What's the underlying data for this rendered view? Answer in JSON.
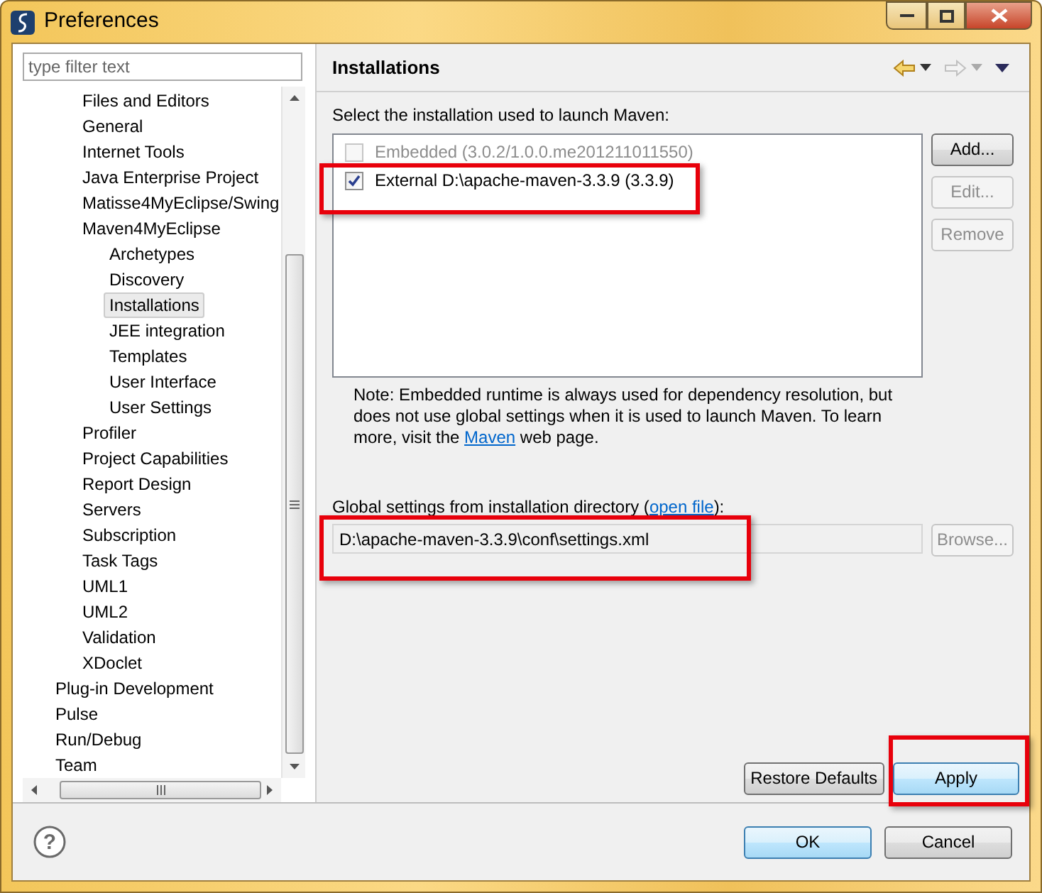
{
  "window": {
    "title": "Preferences"
  },
  "filter": {
    "placeholder": "type filter text"
  },
  "tree": {
    "items": [
      {
        "children": [
          {
            "label": "Files and Editors",
            "selected": false
          },
          {
            "label": "General",
            "selected": false
          },
          {
            "label": "Internet Tools",
            "selected": false
          },
          {
            "label": "Java Enterprise Project",
            "selected": false
          },
          {
            "label": "Matisse4MyEclipse/Swing",
            "selected": false
          },
          {
            "label": "Maven4MyEclipse",
            "selected": false,
            "children": [
              {
                "label": "Archetypes",
                "selected": false
              },
              {
                "label": "Discovery",
                "selected": false
              },
              {
                "label": "Installations",
                "selected": true
              },
              {
                "label": "JEE integration",
                "selected": false
              },
              {
                "label": "Templates",
                "selected": false
              },
              {
                "label": "User Interface",
                "selected": false
              },
              {
                "label": "User Settings",
                "selected": false
              }
            ]
          },
          {
            "label": "Profiler",
            "selected": false
          },
          {
            "label": "Project Capabilities",
            "selected": false
          },
          {
            "label": "Report Design",
            "selected": false
          },
          {
            "label": "Servers",
            "selected": false
          },
          {
            "label": "Subscription",
            "selected": false
          },
          {
            "label": "Task Tags",
            "selected": false
          },
          {
            "label": "UML1",
            "selected": false
          },
          {
            "label": "UML2",
            "selected": false
          },
          {
            "label": "Validation",
            "selected": false
          },
          {
            "label": "XDoclet",
            "selected": false
          }
        ]
      },
      {
        "label": "Plug-in Development",
        "selected": false
      },
      {
        "label": "Pulse",
        "selected": false
      },
      {
        "label": "Run/Debug",
        "selected": false
      },
      {
        "label": "Team",
        "selected": false
      }
    ]
  },
  "page": {
    "title": "Installations",
    "installations_label": "Select the installation used to launch Maven:",
    "installations": [
      {
        "name": "Embedded (3.0.2/1.0.0.me201211011550)",
        "checked": false,
        "disabled": true,
        "highlighted": false
      },
      {
        "name": "External D:\\apache-maven-3.3.9 (3.3.9)",
        "checked": true,
        "disabled": false,
        "highlighted": true
      }
    ],
    "side_buttons": [
      {
        "label": "Add...",
        "disabled": false
      },
      {
        "label": "Edit...",
        "disabled": true
      },
      {
        "label": "Remove",
        "disabled": true
      }
    ],
    "note": {
      "before": "Note: Embedded runtime is always used for dependency resolution, but does not use global settings when it is used to launch Maven. To learn more, visit the ",
      "link": "Maven",
      "after": " web page."
    },
    "settings": {
      "label_before": "Global settings from installation directory (",
      "link": "open file",
      "label_after": "):",
      "value": "D:\\apache-maven-3.3.9\\conf\\settings.xml",
      "highlighted": true,
      "browse": {
        "label": "Browse...",
        "disabled": true
      }
    },
    "buttons": [
      {
        "label": "Restore Defaults",
        "focused": false,
        "highlighted": false
      },
      {
        "label": "Apply",
        "focused": true,
        "highlighted": true
      }
    ]
  },
  "help": {
    "symbol": "?"
  },
  "dialog_buttons": [
    {
      "label": "OK",
      "focused": true
    },
    {
      "label": "Cancel",
      "focused": false
    }
  ]
}
